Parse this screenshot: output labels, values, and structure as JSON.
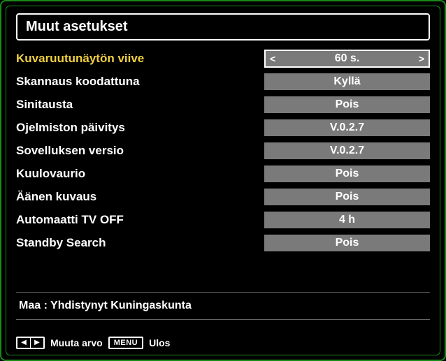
{
  "title": "Muut asetukset",
  "settings": [
    {
      "label": "Kuvaruutunäytön viive",
      "value": "60 s.",
      "active": true
    },
    {
      "label": "Skannaus koodattuna",
      "value": "Kyllä",
      "active": false
    },
    {
      "label": "Sinitausta",
      "value": "Pois",
      "active": false
    },
    {
      "label": "Ojelmiston päivitys",
      "value": "V.0.2.7",
      "active": false
    },
    {
      "label": "Sovelluksen versio",
      "value": "V.0.2.7",
      "active": false
    },
    {
      "label": "Kuulovaurio",
      "value": "Pois",
      "active": false
    },
    {
      "label": "Äänen kuvaus",
      "value": "Pois",
      "active": false
    },
    {
      "label": "Automaatti TV OFF",
      "value": "4 h",
      "active": false
    },
    {
      "label": "Standby Search",
      "value": "Pois",
      "active": false
    }
  ],
  "footer": {
    "country_line": "Maa : Yhdistynyt Kuningaskunta"
  },
  "bottombar": {
    "change_value": "Muuta arvo",
    "menu_label": "MENU",
    "exit_label": "Ulos"
  }
}
